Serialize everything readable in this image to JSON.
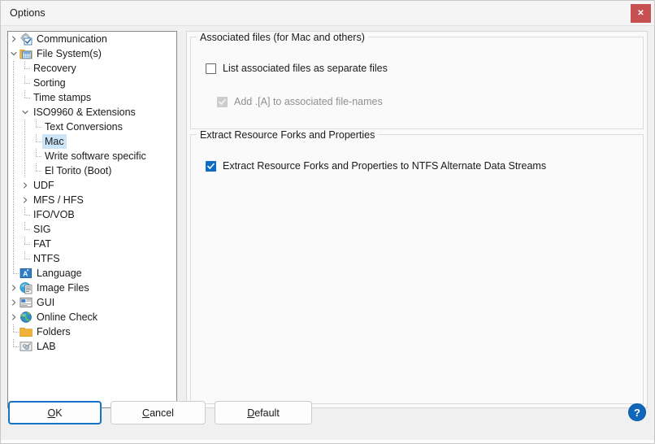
{
  "window": {
    "title": "Options",
    "close_label": "✕"
  },
  "colors": {
    "accent": "#1473c4",
    "selection": "#cbe4f7",
    "checkbox_checked": "#0d6cc4",
    "close_button": "#c75151",
    "help_button": "#1066b8",
    "panel_bg": "#fafafa",
    "tree_bg": "#ffffff",
    "dialog_bg": "#f0f0f0"
  },
  "tree": {
    "items": [
      {
        "label": "Communication",
        "depth": 0,
        "expander": "collapsed",
        "icon": "gear-checkbox-icon",
        "selected": false
      },
      {
        "label": "File System(s)",
        "depth": 0,
        "expander": "expanded",
        "icon": "folder-grid-icon",
        "selected": false
      },
      {
        "label": "Recovery",
        "depth": 1,
        "expander": "none",
        "icon": "none",
        "selected": false
      },
      {
        "label": "Sorting",
        "depth": 1,
        "expander": "none",
        "icon": "none",
        "selected": false
      },
      {
        "label": "Time stamps",
        "depth": 1,
        "expander": "none",
        "icon": "none",
        "selected": false
      },
      {
        "label": "ISO9960 & Extensions",
        "depth": 1,
        "expander": "expanded",
        "icon": "none",
        "selected": false
      },
      {
        "label": "Text Conversions",
        "depth": 2,
        "expander": "none",
        "icon": "none",
        "selected": false
      },
      {
        "label": "Mac",
        "depth": 2,
        "expander": "none",
        "icon": "none",
        "selected": true
      },
      {
        "label": "Write software specific",
        "depth": 2,
        "expander": "none",
        "icon": "none",
        "selected": false
      },
      {
        "label": "El Torito (Boot)",
        "depth": 2,
        "expander": "none",
        "icon": "none",
        "selected": false,
        "last": true
      },
      {
        "label": "UDF",
        "depth": 1,
        "expander": "collapsed",
        "icon": "none",
        "selected": false
      },
      {
        "label": "MFS / HFS",
        "depth": 1,
        "expander": "collapsed",
        "icon": "none",
        "selected": false
      },
      {
        "label": "IFO/VOB",
        "depth": 1,
        "expander": "none",
        "icon": "none",
        "selected": false
      },
      {
        "label": "SIG",
        "depth": 1,
        "expander": "none",
        "icon": "none",
        "selected": false
      },
      {
        "label": "FAT",
        "depth": 1,
        "expander": "none",
        "icon": "none",
        "selected": false
      },
      {
        "label": "NTFS",
        "depth": 1,
        "expander": "none",
        "icon": "none",
        "selected": false,
        "last": true
      },
      {
        "label": "Language",
        "depth": 0,
        "expander": "none",
        "icon": "language-icon",
        "selected": false
      },
      {
        "label": "Image Files",
        "depth": 0,
        "expander": "collapsed",
        "icon": "image-files-icon",
        "selected": false
      },
      {
        "label": "GUI",
        "depth": 0,
        "expander": "collapsed",
        "icon": "gui-window-icon",
        "selected": false
      },
      {
        "label": "Online Check",
        "depth": 0,
        "expander": "collapsed",
        "icon": "globe-icon",
        "selected": false
      },
      {
        "label": "Folders",
        "depth": 0,
        "expander": "none",
        "icon": "folder-icon",
        "selected": false
      },
      {
        "label": "LAB",
        "depth": 0,
        "expander": "none",
        "icon": "lab-icon",
        "selected": false,
        "last": true
      }
    ]
  },
  "groups": [
    {
      "title": "Associated files (for Mac and others)",
      "options": [
        {
          "label": "List associated files as separate files",
          "checked": false,
          "disabled": false
        },
        {
          "label": "Add .[A] to associated file-names",
          "checked": true,
          "disabled": true
        }
      ]
    },
    {
      "title": "Extract Resource Forks and Properties",
      "options": [
        {
          "label": "Extract Resource Forks and Properties to NTFS Alternate Data Streams",
          "checked": true,
          "disabled": false
        }
      ]
    }
  ],
  "buttons": {
    "ok": {
      "prefix": "",
      "accel": "O",
      "suffix": "K"
    },
    "cancel": {
      "prefix": "",
      "accel": "C",
      "suffix": "ancel"
    },
    "default": {
      "prefix": "",
      "accel": "D",
      "suffix": "efault"
    },
    "help": "?"
  }
}
